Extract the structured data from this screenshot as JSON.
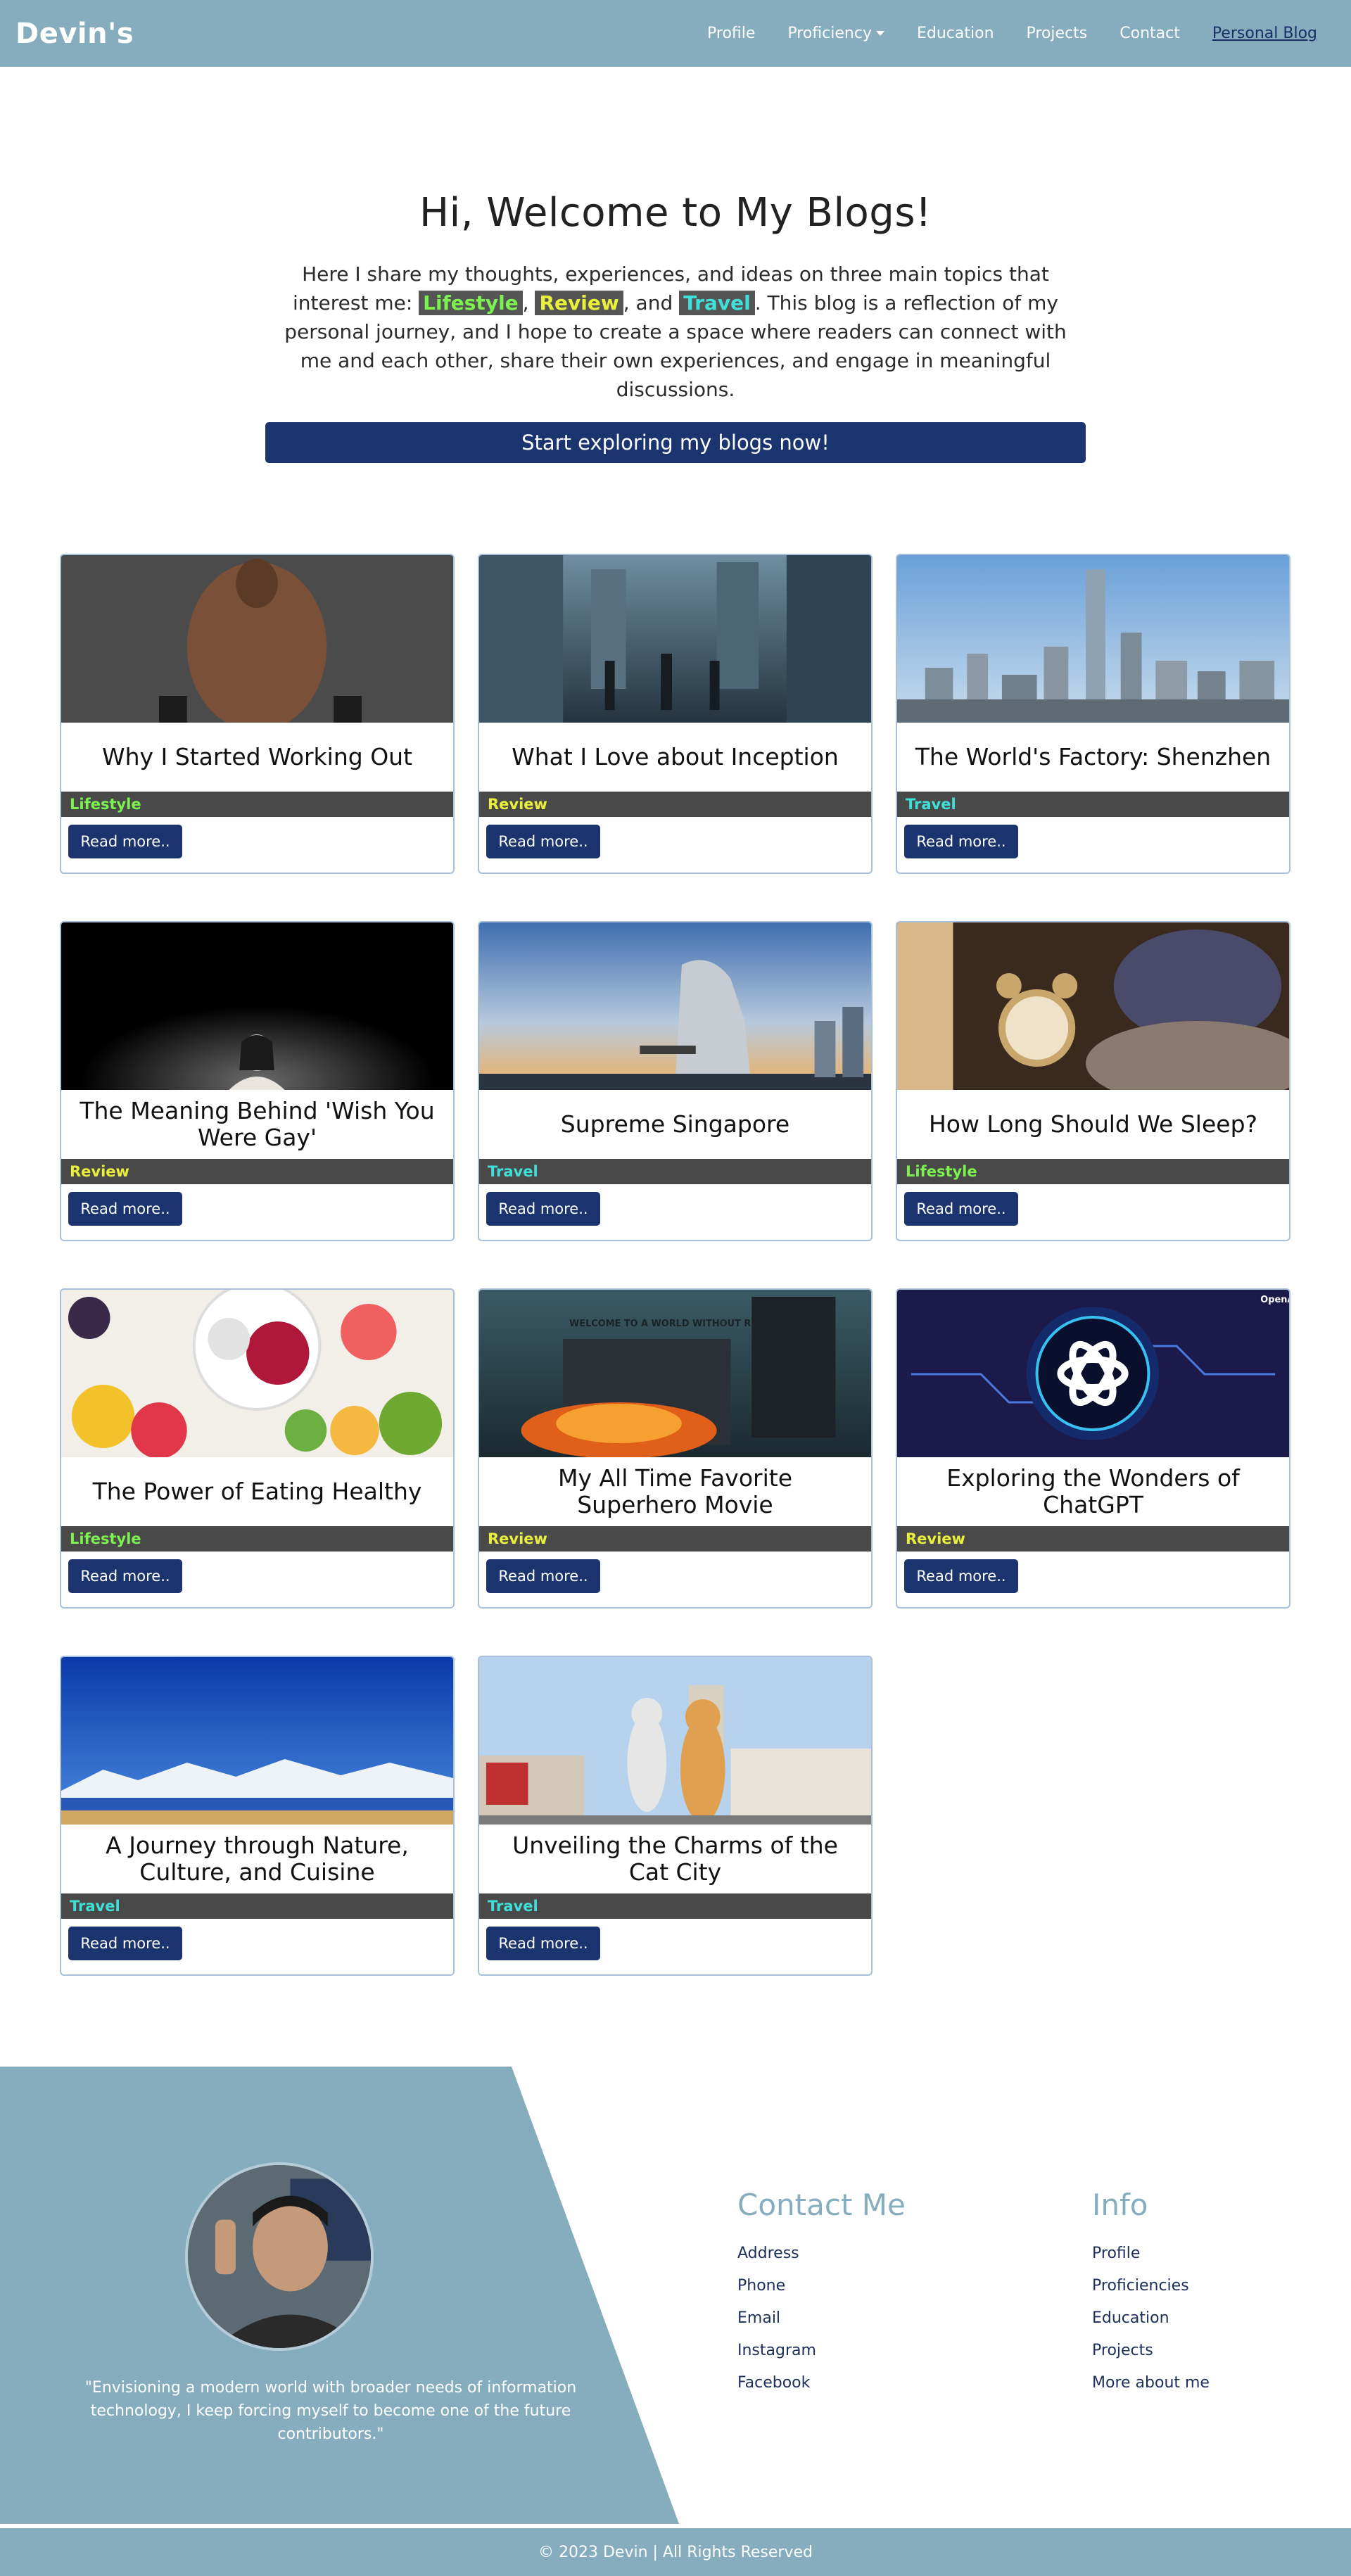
{
  "nav": {
    "brand": "Devin's",
    "links": [
      {
        "label": "Profile"
      },
      {
        "label": "Proficiency"
      },
      {
        "label": "Education"
      },
      {
        "label": "Projects"
      },
      {
        "label": "Contact"
      },
      {
        "label": "Personal Blog"
      }
    ]
  },
  "hero": {
    "title": "Hi, Welcome to My Blogs!",
    "text_before": "Here I share my thoughts, experiences, and ideas on three main topics that interest me: ",
    "topics": [
      "Lifestyle",
      "Review",
      "Travel"
    ],
    "sep1": ", ",
    "sep2": ", and ",
    "text_after": ". This blog is a reflection of my personal journey, and I hope to create a space where readers can connect with me and each other, share their own experiences, and engage in meaningful discussions.",
    "cta": "Start exploring my blogs now!"
  },
  "posts": [
    {
      "title": "Why I Started Working Out",
      "category": "Lifestyle",
      "button": "Read more.."
    },
    {
      "title": "What I Love about Inception",
      "category": "Review",
      "button": "Read more.."
    },
    {
      "title": "The World's Factory: Shenzhen",
      "category": "Travel",
      "button": "Read more.."
    },
    {
      "title": "The Meaning Behind 'Wish You Were Gay'",
      "category": "Review",
      "button": "Read more.."
    },
    {
      "title": "Supreme Singapore",
      "category": "Travel",
      "button": "Read more.."
    },
    {
      "title": "How Long Should We Sleep?",
      "category": "Lifestyle",
      "button": "Read more.."
    },
    {
      "title": "The Power of Eating Healthy",
      "category": "Lifestyle",
      "button": "Read more.."
    },
    {
      "title": "My All Time Favorite Superhero Movie",
      "category": "Review",
      "button": "Read more..",
      "image_text": "WELCOME TO A WORLD WITHOUT RULES."
    },
    {
      "title": "Exploring the Wonders of ChatGPT",
      "category": "Review",
      "button": "Read more..",
      "image_text": "OpenAI"
    },
    {
      "title": "A Journey through Nature, Culture, and Cuisine",
      "category": "Travel",
      "button": "Read more.."
    },
    {
      "title": "Unveiling the Charms of the Cat City",
      "category": "Travel",
      "button": "Read more.."
    }
  ],
  "footer": {
    "quote": "\"Envisioning a modern world with broader needs of information technology, I keep forcing myself to become one of the future contributors.\"",
    "contact": {
      "heading": "Contact Me",
      "links": [
        "Address",
        "Phone",
        "Email",
        "Instagram",
        "Facebook"
      ]
    },
    "info": {
      "heading": "Info",
      "links": [
        "Profile",
        "Proficiencies",
        "Education",
        "Projects",
        "More about me"
      ]
    },
    "copyright": "© 2023 Devin | All Rights Reserved"
  },
  "colors": {
    "nav_bg": "#85adbe",
    "button_bg": "#1b336e",
    "tag_bg": "#494949",
    "lifestyle": "#7cf24e",
    "review": "#e8f03c",
    "travel": "#3fe0d8"
  }
}
